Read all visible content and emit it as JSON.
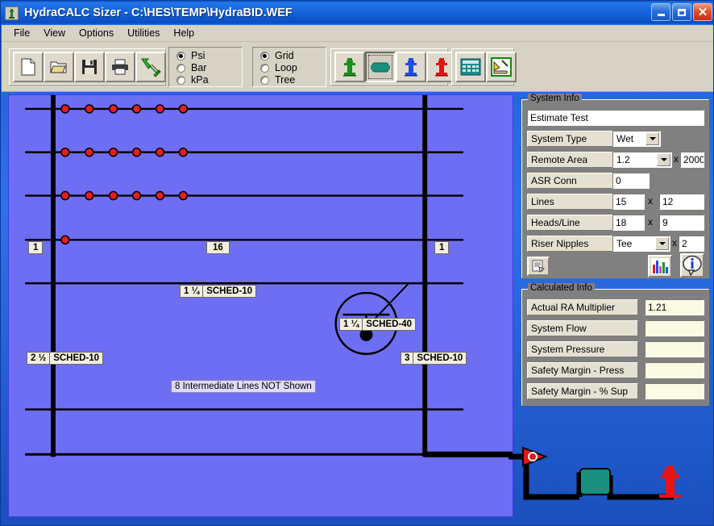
{
  "window": {
    "title": "HydraCALC Sizer - C:\\HES\\TEMP\\HydraBID.WEF",
    "app_icon": "hydrant-icon",
    "minimize": "minimize-icon",
    "maximize": "maximize-icon",
    "close": "✕"
  },
  "menu": [
    {
      "label": "File"
    },
    {
      "label": "View"
    },
    {
      "label": "Options"
    },
    {
      "label": "Utilities"
    },
    {
      "label": "Help"
    }
  ],
  "toolbar": {
    "file_buttons": [
      {
        "name": "new-file-button",
        "icon": "new-document-icon"
      },
      {
        "name": "open-file-button",
        "icon": "open-folder-icon"
      },
      {
        "name": "save-file-button",
        "icon": "floppy-disk-icon"
      },
      {
        "name": "print-button",
        "icon": "printer-icon"
      },
      {
        "name": "sizer-wizard-button",
        "icon": "green-arrow-hose-icon"
      }
    ],
    "units_group": {
      "name": "units-radio-group",
      "options": [
        {
          "label": "Psi",
          "selected": true
        },
        {
          "label": "Bar",
          "selected": false
        },
        {
          "label": "kPa",
          "selected": false
        }
      ]
    },
    "layout_group": {
      "name": "layout-radio-group",
      "options": [
        {
          "label": "Grid",
          "selected": true
        },
        {
          "label": "Loop",
          "selected": false
        },
        {
          "label": "Tree",
          "selected": false
        }
      ]
    },
    "component_buttons": [
      {
        "name": "green-hydrant-button",
        "icon": "green-hydrant-icon",
        "pressed": false
      },
      {
        "name": "pump-button",
        "icon": "teal-pump-icon",
        "pressed": true
      },
      {
        "name": "blue-hydrant-button",
        "icon": "blue-hydrant-icon",
        "pressed": false
      },
      {
        "name": "red-hydrant-button",
        "icon": "red-hydrant-icon",
        "pressed": false
      }
    ],
    "tool_buttons": [
      {
        "name": "calculator-button",
        "icon": "calculator-icon"
      },
      {
        "name": "design-tools-button",
        "icon": "hammer-ruler-icon"
      }
    ]
  },
  "canvas": {
    "name": "system-diagram",
    "background_color": "#6e6ef4",
    "labels": [
      {
        "id": "left-branch-count",
        "text": "1"
      },
      {
        "id": "main-line-count",
        "text": "16"
      },
      {
        "id": "right-branch-count",
        "text": "1"
      },
      {
        "id": "cross-main-size",
        "size": "1 ¼",
        "schedule": "SCHED-10"
      },
      {
        "id": "callout-size",
        "size": "1 ¼",
        "schedule": "SCHED-40"
      },
      {
        "id": "left-riser-size",
        "size": "2 ½",
        "schedule": "SCHED-10"
      },
      {
        "id": "right-riser-size",
        "size": "3",
        "schedule": "SCHED-10"
      },
      {
        "id": "hidden-lines-note",
        "text": "8 Intermediate Lines NOT Shown"
      }
    ],
    "sprinkler_lines": 3,
    "sprinklers_per_line": 6
  },
  "system_info": {
    "title": "System Info",
    "project_name": "Estimate Test",
    "fields": [
      {
        "label": "System Type",
        "type": "combo",
        "value": "Wet"
      },
      {
        "label": "Remote Area",
        "type": "combo",
        "value": "1.2",
        "mult_label": "x",
        "mult_value": "2000"
      },
      {
        "label": "ASR Conn",
        "type": "text",
        "value": "0"
      },
      {
        "label": "Lines",
        "type": "text",
        "value": "15",
        "mult_label": "x",
        "mult_value": "12"
      },
      {
        "label": "Heads/Line",
        "type": "text",
        "value": "18",
        "mult_label": "x",
        "mult_value": "9"
      },
      {
        "label": "Riser Nipples",
        "type": "combo",
        "value": "Tee",
        "mult_label": "x",
        "mult_value": "2"
      }
    ],
    "buttons": [
      {
        "name": "report-button",
        "icon": "report-page-icon"
      },
      {
        "name": "graph-button",
        "icon": "bar-chart-icon"
      },
      {
        "name": "info-button",
        "icon": "info-balloon-icon"
      }
    ]
  },
  "calculated_info": {
    "title": "Calculated Info",
    "rows": [
      {
        "label": "Actual RA Multiplier",
        "value": "1.21"
      },
      {
        "label": "System Flow",
        "value": ""
      },
      {
        "label": "System Pressure",
        "value": ""
      },
      {
        "label": "Safety Margin - Press",
        "value": ""
      },
      {
        "label": "Safety Margin - % Sup",
        "value": ""
      }
    ]
  },
  "colors": {
    "titlebar": "#1565dd",
    "canvas": "#6e6ef4",
    "panel": "#808080",
    "chrome": "#d6d2c4",
    "sprinkler": "#e02020",
    "pump": "#19907f",
    "hydrant_red": "#e81414"
  }
}
